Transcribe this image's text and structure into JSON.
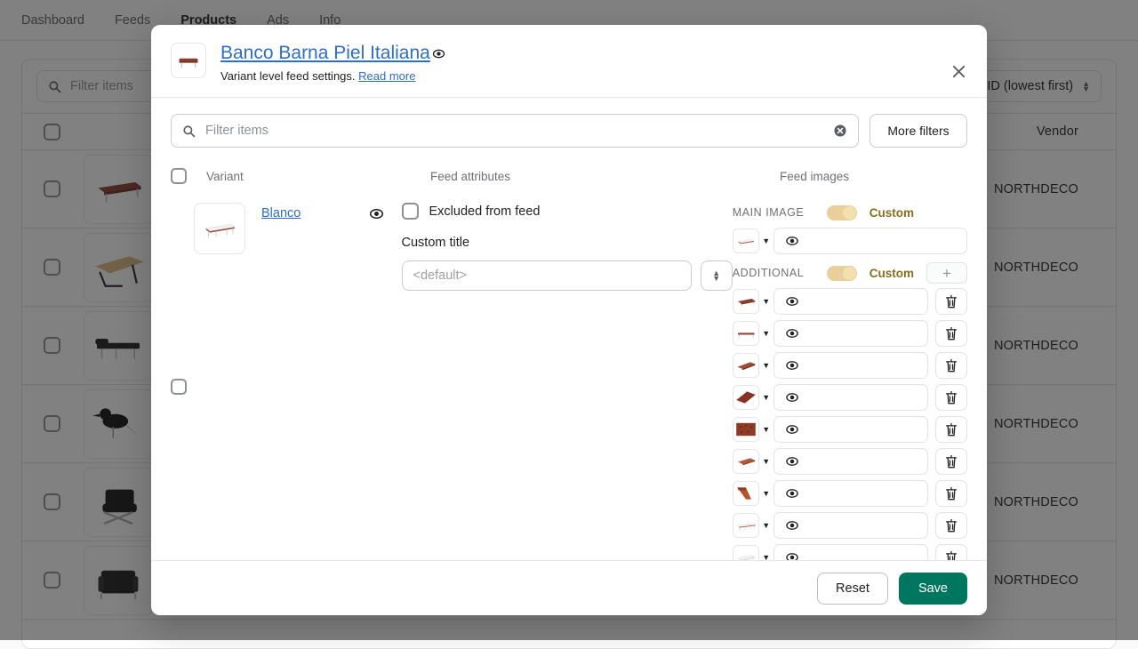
{
  "background": {
    "nav": [
      {
        "label": "Dashboard",
        "active": false
      },
      {
        "label": "Feeds",
        "active": false
      },
      {
        "label": "Products",
        "active": true
      },
      {
        "label": "Ads",
        "active": false
      },
      {
        "label": "Info",
        "active": false
      }
    ],
    "search_placeholder": "Filter items",
    "sort_label": "ID (lowest first)",
    "columns": {
      "vendor": "Vendor"
    },
    "rows": [
      {
        "vendor": "NORTHDECO",
        "thumb": "bench-brown-leather"
      },
      {
        "vendor": "NORTHDECO",
        "thumb": "table-wood-tan"
      },
      {
        "vendor": "NORTHDECO",
        "thumb": "daybed-black"
      },
      {
        "vendor": "NORTHDECO",
        "thumb": "bird-sculpture-black"
      },
      {
        "vendor": "NORTHDECO",
        "thumb": "barcelona-chair-black"
      },
      {
        "vendor": "NORTHDECO",
        "thumb": "lc2-armchair-black"
      }
    ]
  },
  "modal": {
    "title": "Banco Barna Piel Italiana",
    "subtitle_text": "Variant level feed settings.",
    "subtitle_link": "Read more",
    "thumb": "bench-brown-leather",
    "close_icon": "close-icon",
    "preview_icon": "eye-icon",
    "filter": {
      "placeholder": "Filter items",
      "search_icon": "search-icon",
      "clear_icon": "clear-circle-icon",
      "more_filters_label": "More filters"
    },
    "columns": {
      "variant": "Variant",
      "feed_attributes": "Feed attributes",
      "feed_images": "Feed images"
    },
    "variant": {
      "name": "Blanco",
      "thumb": "bench-white-top",
      "eye_icon": "eye-icon"
    },
    "attributes": {
      "excluded_label": "Excluded from feed",
      "excluded_checked": false,
      "custom_title_label": "Custom title",
      "custom_title_value": "",
      "custom_title_placeholder": "<default>",
      "stepper_icon": "stepper-updown-icon"
    },
    "images": {
      "main": {
        "section_label": "MAIN IMAGE",
        "toggle_label": "Custom",
        "toggle_on": true,
        "value": "",
        "thumb": "bench-white-top"
      },
      "additional": {
        "section_label": "ADDITIONAL",
        "toggle_label": "Custom",
        "toggle_on": true,
        "add_label": "+",
        "items": [
          {
            "thumb": "bench-brown-leather-angle",
            "value": ""
          },
          {
            "thumb": "bench-brown-side",
            "value": ""
          },
          {
            "thumb": "bench-brown-perspective",
            "value": ""
          },
          {
            "thumb": "leather-tufted-closeup",
            "value": ""
          },
          {
            "thumb": "leather-tufted-detail",
            "value": ""
          },
          {
            "thumb": "bench-brown-top",
            "value": ""
          },
          {
            "thumb": "bench-leg-detail",
            "value": ""
          },
          {
            "thumb": "bench-white-long",
            "value": ""
          },
          {
            "thumb": "bench-white-angle",
            "value": ""
          }
        ]
      }
    },
    "footer": {
      "reset_label": "Reset",
      "save_label": "Save"
    }
  },
  "colors": {
    "link": "#2c6ecb",
    "save_green": "#00765f",
    "toggle_track": "#e8cf9b",
    "toggle_knob": "#f2e0ae",
    "toggle_text": "#8a6d1f",
    "overlay": "#1a1a1a"
  }
}
